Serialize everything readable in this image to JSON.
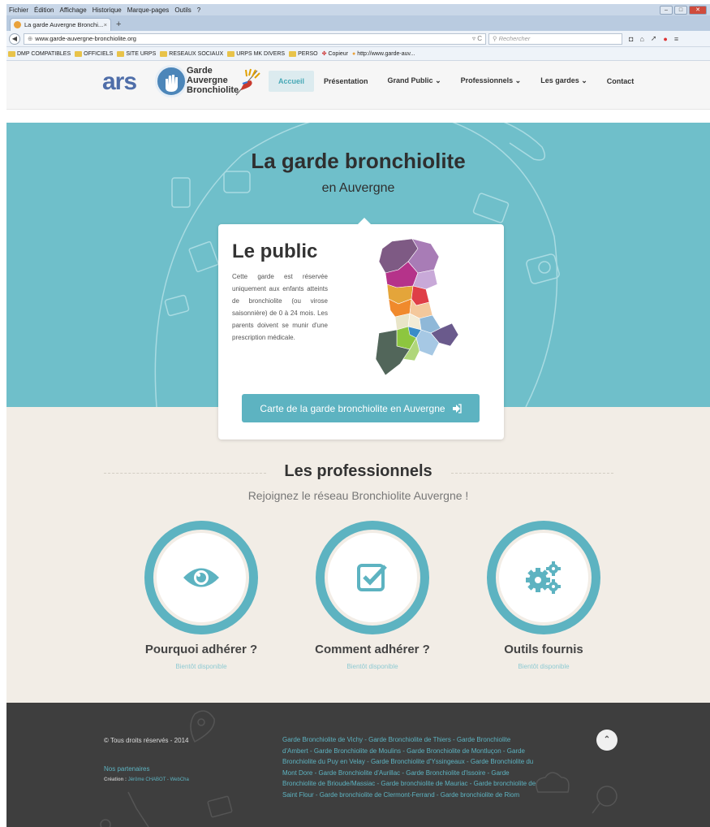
{
  "browser": {
    "menu": [
      "Fichier",
      "Édition",
      "Affichage",
      "Historique",
      "Marque-pages",
      "Outils",
      "?"
    ],
    "tab_title": "La garde Auvergne Bronchi...",
    "tab_close": "×",
    "new_tab": "+",
    "url": "www.garde-auvergne-bronchiolite.org",
    "search_placeholder": "Rechercher",
    "bookmarks": [
      "DMP COMPATIBLES",
      "OFFICIELS",
      "SITE URPS",
      "RESEAUX SOCIAUX",
      "URPS MK DIVERS",
      "PERSO",
      "Copieur",
      "http://www.garde-auv..."
    ]
  },
  "header": {
    "logo_ars": "ars",
    "logo_line1": "Garde",
    "logo_line2": "Auvergne",
    "logo_line3": "Bronchiolite",
    "nav": [
      "Accueil",
      "Présentation",
      "Grand Public",
      "Professionnels",
      "Les gardes",
      "Contact"
    ],
    "nav_dropdown_arrow": "⌄"
  },
  "hero": {
    "title": "La garde bronchiolite",
    "subtitle": "en Auvergne"
  },
  "card": {
    "title": "Le public",
    "text": "Cette garde est réservée uniquement aux enfants atteints de bronchiolite (ou virose saisonnière) de 0 à 24 mois. Les parents doivent se munir d'une prescription médicale.",
    "button": "Carte de la garde bronchiolite en Auvergne",
    "button_icon": "sign-in-icon"
  },
  "pros": {
    "title": "Les professionnels",
    "subtitle": "Rejoignez le réseau Bronchiolite Auvergne !",
    "features": [
      {
        "title": "Pourquoi adhérer ?",
        "sub": "Bientôt disponible",
        "icon": "eye-icon"
      },
      {
        "title": "Comment adhérer ?",
        "sub": "Bientôt disponible",
        "icon": "checkbox-icon"
      },
      {
        "title": "Outils fournis",
        "sub": "Bientôt disponible",
        "icon": "gears-icon"
      }
    ]
  },
  "footer": {
    "copyright": "© Tous droits réservés - 2014",
    "partners": "Nos partenaires",
    "credit_label": "Création :",
    "credit_name": "Jérôme CHABOT - WebCha",
    "links": "Garde Bronchiolite de Vichy - Garde Bronchiolite de Thiers - Garde Bronchiolite d'Ambert - Garde Bronchiolite de Moulins - Garde Bronchiolite de Montluçon - Garde Bronchiolite du Puy en Velay - Garde Bronchiolite d'Yssingeaux - Garde Bronchiolite du Mont Dore - Garde Bronchiolite d'Aurillac - Garde Bronchiolite d'Issoire - Garde Bronchiolite de Brioude/Massiac - Garde bronchiolite de Mauriac - Garde bronchiolite de Saint Flour - Garde bronchiolite de Clermont-Ferrand - Garde bronchiolite de Riom",
    "to_top_icon": "chevron-up-icon"
  },
  "colors": {
    "accent": "#5db3c1",
    "hero_bg": "#6fbfca",
    "section_bg": "#f2ede6",
    "footer_bg": "#3e3e3e"
  }
}
